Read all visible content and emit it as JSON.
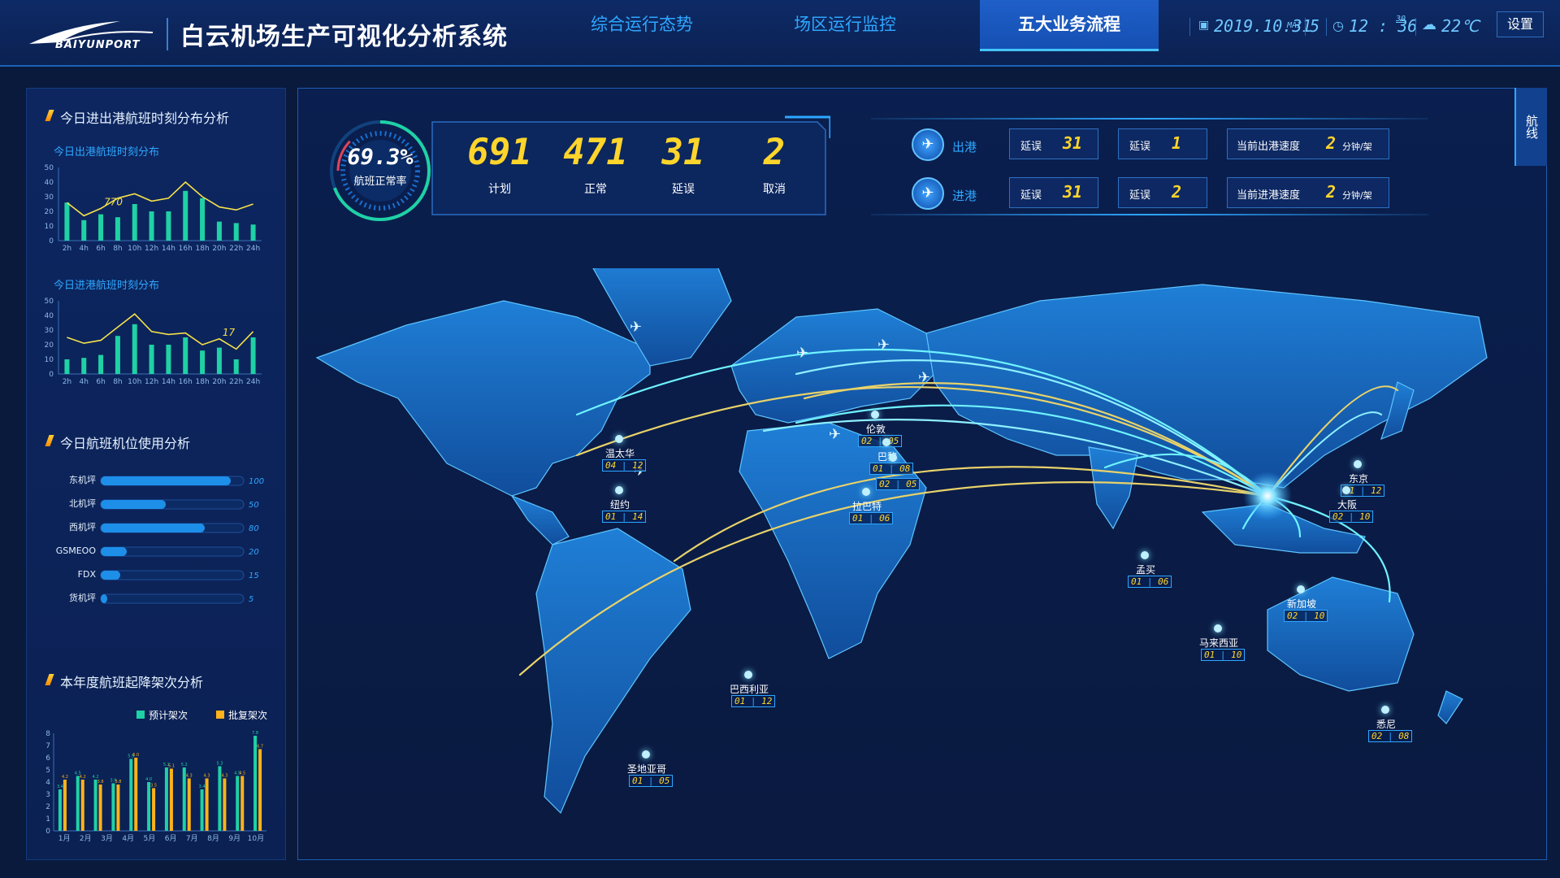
{
  "header": {
    "logo_text": "BAIYUNPORT",
    "title": "白云机场生产可视化分析系统",
    "nav": [
      "综合运行态势",
      "场区运行监控",
      "五大业务流程"
    ],
    "active_nav": "五大业务流程",
    "date": "2019.10.31",
    "weekday_label": "MAI",
    "weekday_value": "5",
    "time": "12 : 36",
    "seconds": "30",
    "temperature": "22℃",
    "settings_label": "设置"
  },
  "left": {
    "section1_title": "今日进出港航班时刻分布分析",
    "dep_chart_title": "今日出港航班时刻分布",
    "arr_chart_title": "今日进港航班时刻分布",
    "section2_title": "今日航班机位使用分析",
    "section3_title": "本年度航班起降架次分析",
    "legend_planned": "预计架次",
    "legend_approved": "批复架次"
  },
  "kpi": {
    "ratio": "69.3%",
    "ratio_label": "航班正常率",
    "ratio_value": 0.693,
    "items": [
      {
        "value": "691",
        "label": "计划"
      },
      {
        "value": "471",
        "label": "正常"
      },
      {
        "value": "31",
        "label": "延误"
      },
      {
        "value": "2",
        "label": "取消"
      }
    ]
  },
  "flow": {
    "departure": {
      "label": "出港",
      "delay1_label": "延误",
      "delay1": "31",
      "delay2_label": "延误",
      "delay2": "1",
      "speed_label": "当前出港速度",
      "speed": "2",
      "speed_unit": "分钟/架"
    },
    "arrival": {
      "label": "进港",
      "delay1_label": "延误",
      "delay1": "31",
      "delay2_label": "延误",
      "delay2": "2",
      "speed_label": "当前进港速度",
      "speed": "2",
      "speed_unit": "分钟/架"
    }
  },
  "side_tab": "航线",
  "cities": [
    {
      "name": "温太华",
      "a": "04",
      "b": "12"
    },
    {
      "name": "纽约",
      "a": "01",
      "b": "14"
    },
    {
      "name": "伦敦",
      "a": "02",
      "b": "05"
    },
    {
      "name": "巴黎",
      "a": "01",
      "b": "08"
    },
    {
      "name": "",
      "a": "02",
      "b": "05"
    },
    {
      "name": "拉巴特",
      "a": "01",
      "b": "06"
    },
    {
      "name": "东京",
      "a": "01",
      "b": "12"
    },
    {
      "name": "大阪",
      "a": "02",
      "b": "10"
    },
    {
      "name": "孟买",
      "a": "01",
      "b": "06"
    },
    {
      "name": "新加坡",
      "a": "02",
      "b": "10"
    },
    {
      "name": "马来西亚",
      "a": "01",
      "b": "10"
    },
    {
      "name": "巴西利亚",
      "a": "01",
      "b": "12"
    },
    {
      "name": "圣地亚哥",
      "a": "01",
      "b": "05"
    },
    {
      "name": "悉尼",
      "a": "02",
      "b": "08"
    }
  ],
  "chart_data": [
    {
      "type": "bar",
      "title": "今日出港航班时刻分布",
      "categories": [
        "2h",
        "4h",
        "6h",
        "8h",
        "10h",
        "12h",
        "14h",
        "16h",
        "18h",
        "20h",
        "22h",
        "24h"
      ],
      "ylim": [
        0,
        50
      ],
      "yticks": [
        0,
        10,
        20,
        30,
        40,
        50
      ],
      "series": [
        {
          "values": [
            26,
            14,
            18,
            16,
            25,
            20,
            20,
            34,
            29,
            13,
            12,
            11
          ]
        }
      ],
      "line": [
        26,
        17,
        22,
        29,
        32,
        27,
        29,
        40,
        30,
        23,
        21,
        25
      ],
      "annotation": "770"
    },
    {
      "type": "bar",
      "title": "今日进港航班时刻分布",
      "categories": [
        "2h",
        "4h",
        "6h",
        "8h",
        "10h",
        "12h",
        "14h",
        "16h",
        "18h",
        "20h",
        "22h",
        "24h"
      ],
      "ylim": [
        0,
        50
      ],
      "yticks": [
        0,
        10,
        20,
        30,
        40,
        50
      ],
      "series": [
        {
          "values": [
            10,
            11,
            13,
            26,
            34,
            20,
            20,
            25,
            16,
            18,
            10,
            25
          ]
        }
      ],
      "line": [
        25,
        21,
        23,
        32,
        41,
        29,
        27,
        28,
        20,
        24,
        17,
        29
      ],
      "annotation": "17"
    },
    {
      "type": "bar",
      "title": "今日航班机位使用分析",
      "categories": [
        "东机坪",
        "北机坪",
        "西机坪",
        "GSMEOO",
        "FDX",
        "货机坪"
      ],
      "values": [
        100,
        50,
        80,
        20,
        15,
        5
      ],
      "value_labels": [
        "100",
        "50",
        "80",
        "20",
        "15",
        "5"
      ],
      "xlim": [
        0,
        110
      ]
    },
    {
      "type": "bar",
      "title": "本年度航班起降架次分析",
      "categories": [
        "1月",
        "2月",
        "3月",
        "4月",
        "5月",
        "6月",
        "7月",
        "8月",
        "9月",
        "10月"
      ],
      "ylim": [
        0,
        8
      ],
      "yticks": [
        0,
        1,
        2,
        3,
        4,
        5,
        6,
        7,
        8
      ],
      "series": [
        {
          "name": "预计架次",
          "values": [
            3.4,
            4.5,
            4.2,
            3.9,
            5.9,
            4.0,
            5.2,
            5.2,
            3.4,
            5.3,
            4.5,
            7.8
          ]
        },
        {
          "name": "批复架次",
          "values": [
            4.2,
            4.2,
            3.8,
            3.8,
            6.0,
            3.5,
            5.1,
            4.3,
            4.3,
            4.3,
            4.5,
            6.7
          ]
        }
      ],
      "value_labels_a": [
        "3.4",
        "4.5",
        "4.2",
        "3.9",
        "5.9",
        "4.0",
        "5.2",
        "5.2",
        "3.4",
        "5.3",
        "4.5",
        "7.8"
      ],
      "value_labels_b": [
        "4.2",
        "4.2",
        "3.8",
        "3.8",
        "6.0",
        "3.5",
        "5.1",
        "4.3",
        "4.3",
        "4.3",
        "4.5",
        "6.7"
      ]
    }
  ],
  "colors": {
    "accent": "#2ea7ff",
    "gold": "#ffd52b",
    "teal": "#1fd1a5",
    "orange": "#ffb21a",
    "bar_blue": "#1d8fe8"
  }
}
